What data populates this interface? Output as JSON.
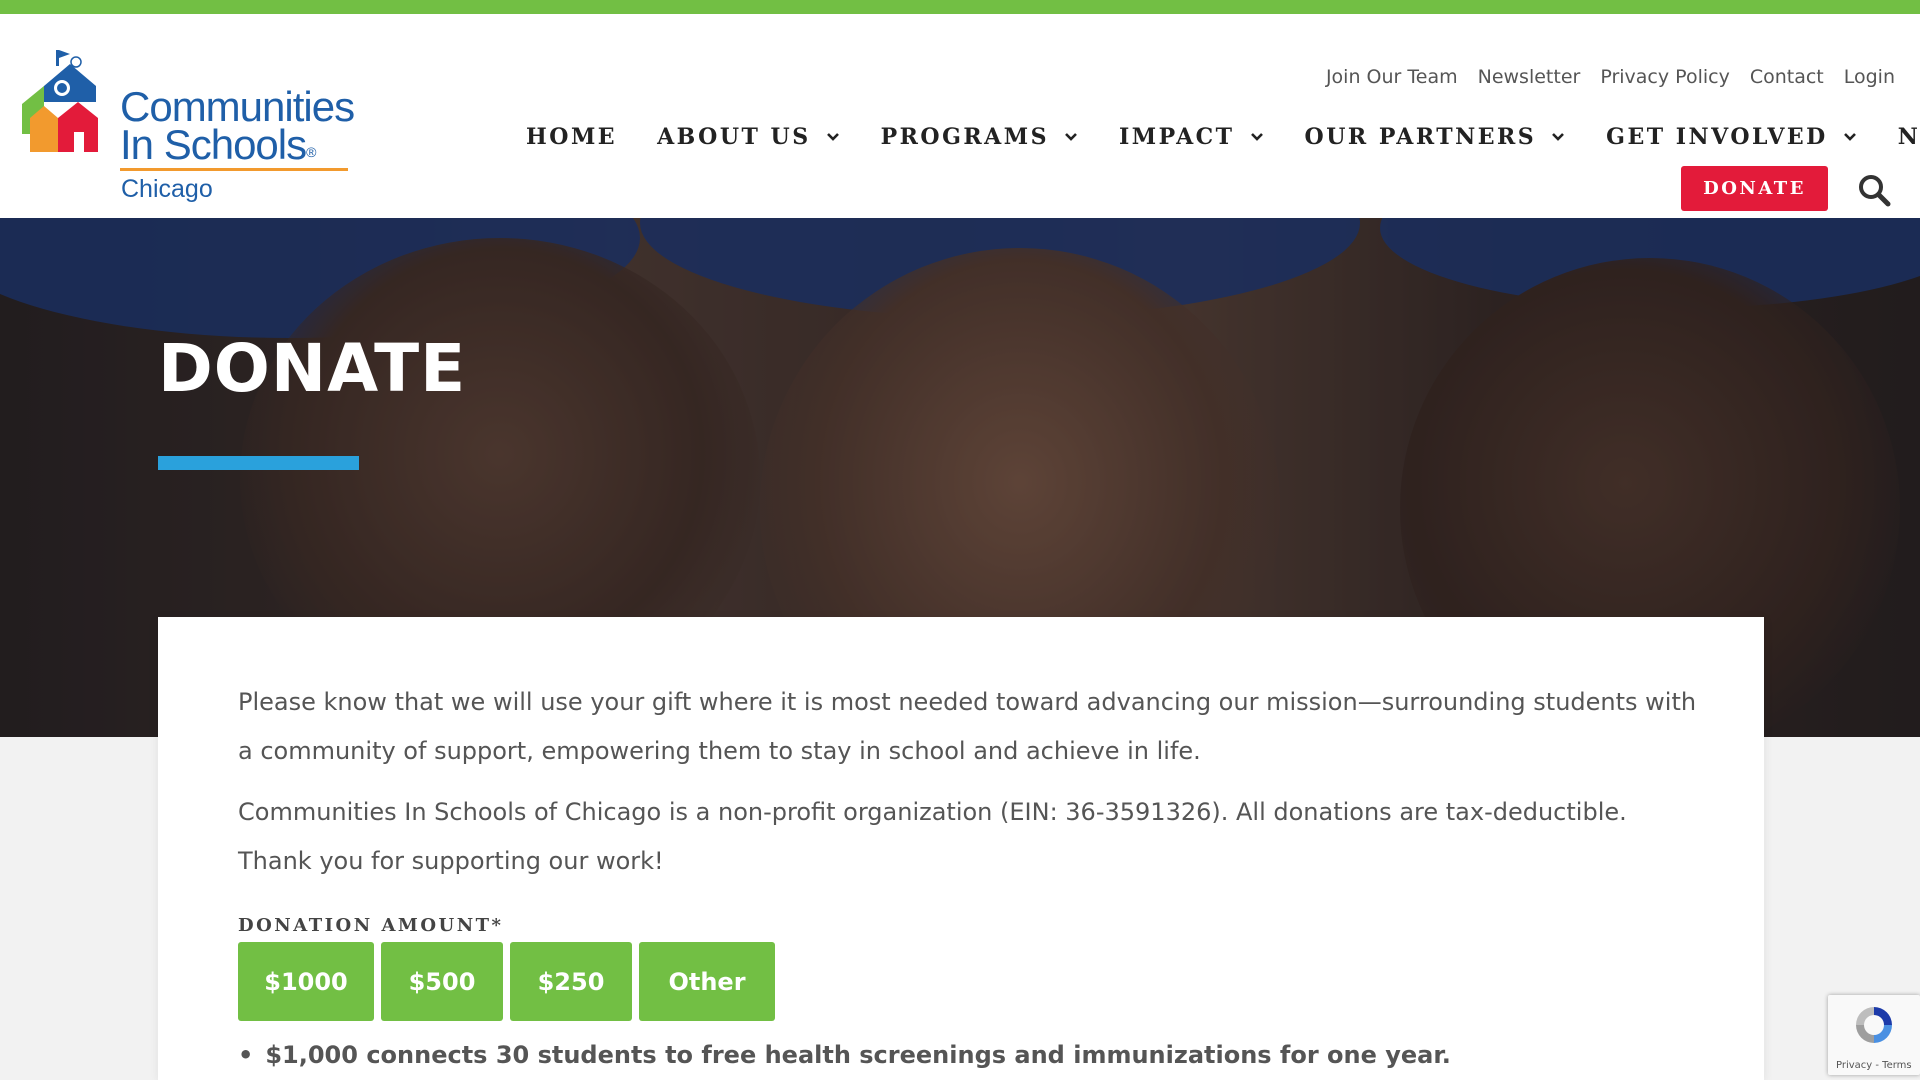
{
  "brand": {
    "line1": "Communities",
    "line2": "In Schools",
    "reg": "®",
    "city": "Chicago",
    "colors": {
      "green": "#72bf44",
      "blue": "#1f5fa8",
      "orange": "#f29a2e",
      "red": "#e31b3a",
      "accent_blue": "#2aa1dc"
    }
  },
  "utility_nav": [
    "Join Our Team",
    "Newsletter",
    "Privacy Policy",
    "Contact",
    "Login"
  ],
  "main_nav": [
    {
      "label": "HOME",
      "dropdown": false
    },
    {
      "label": "ABOUT US",
      "dropdown": true
    },
    {
      "label": "PROGRAMS",
      "dropdown": true
    },
    {
      "label": "IMPACT",
      "dropdown": true
    },
    {
      "label": "OUR PARTNERS",
      "dropdown": true
    },
    {
      "label": "GET INVOLVED",
      "dropdown": true
    },
    {
      "label": "NEWS",
      "dropdown": true
    }
  ],
  "header": {
    "donate_label": "DONATE",
    "search_icon": "search-icon"
  },
  "hero": {
    "title": "DONATE"
  },
  "content": {
    "paragraph1": "Please know that we will use your gift where it is most needed toward advancing our mission—surrounding students with a community of support, empowering them to stay in school and achieve in life.",
    "paragraph2": "Communities In Schools of Chicago is a non-profit organization (EIN: 36-3591326). All donations are tax-deductible. Thank you for supporting our work!",
    "amount_label": "DONATION AMOUNT*",
    "amounts": [
      "$1000",
      "$500",
      "$250",
      "Other"
    ],
    "bullet": "$1,000 connects 30 students to free health screenings and immunizations for one year."
  },
  "recaptcha": {
    "links": "Privacy - Terms"
  }
}
